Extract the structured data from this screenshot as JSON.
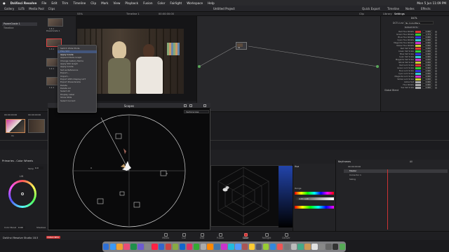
{
  "menubar": {
    "apple": "",
    "app": "DaVinci Resolve",
    "items": [
      "File",
      "Edit",
      "Trim",
      "Timeline",
      "Clip",
      "Mark",
      "View",
      "Playback",
      "Fusion",
      "Color",
      "Fairlight",
      "Workspace",
      "Help"
    ],
    "clock": "Mon 5 Jun 11:09 PM"
  },
  "toolbar": {
    "left": [
      "Gallery",
      "LUTs",
      "Media Pool",
      "Clips"
    ],
    "project_title": "Untitled Project",
    "right": [
      "Quick Export",
      "Timeline",
      "Nodes",
      "Effects"
    ]
  },
  "secondary": {
    "zoom": "53%",
    "timeline_label": "Timeline 1",
    "timecode": "00:00:00:00",
    "clip_label": "Clip",
    "library_tab": "Library",
    "settings_tab": "Settings"
  },
  "gallery": {
    "albums": [
      "PowerGrade 1",
      "Timeline"
    ],
    "stills": [
      {
        "label": "1.6.1",
        "sub": "PowerGrade 1"
      },
      {
        "label": "1.3.1",
        "sub": ""
      },
      {
        "label": "1.2.1",
        "sub": ""
      },
      {
        "label": "1.1.1",
        "sub": ""
      }
    ]
  },
  "context_menu": {
    "items": [
      "Switch Wide Mode",
      "Play Still",
      "Apply Grade",
      "Append Node Graph",
      "Change Gallery Name",
      "Apply Still Graph",
      "Apply Grade",
      "Set as Reference",
      "Export...",
      "Import...",
      "Export With Display LUT",
      "Export PowerGrade",
      "Delete",
      "Delete All",
      "Select All",
      "Display Label",
      "Show Stills",
      "Select Current"
    ],
    "highlighted_index": 2
  },
  "right_panel": {
    "header": "DCTL",
    "dctl_label": "DCTL List",
    "dctl_value": "No ColorWarp",
    "sub": "Default DCTL",
    "rows": [
      {
        "label": "Red Hue Rotate",
        "color": "#d33",
        "value": "0.000"
      },
      {
        "label": "Green Hue Rotate",
        "color": "#3c3",
        "value": "1.374"
      },
      {
        "label": "Blue Hue Rotate",
        "color": "#33d",
        "value": "0.000"
      },
      {
        "label": "Cyan Hue Rotate",
        "color": "#3cc",
        "value": "0.000"
      },
      {
        "label": "Magenta Hue Rotate",
        "color": "#c3c",
        "value": "0.000"
      },
      {
        "label": "Yellow Hue Rotate",
        "color": "#cc3",
        "value": "0.000"
      },
      {
        "label": "Red Sat Scale",
        "color": "#d33",
        "value": "0.000"
      },
      {
        "label": "Green Sat Scale",
        "color": "#3c3",
        "value": "0.000"
      },
      {
        "label": "Blue Sat Scale",
        "color": "#33d",
        "value": "0.000"
      },
      {
        "label": "Cyan Sat Scale",
        "color": "#3cc",
        "value": "0.000"
      },
      {
        "label": "Magenta Sat Scale",
        "color": "#c3c",
        "value": "0.000"
      },
      {
        "label": "Yellow Sat Scale",
        "color": "#cc3",
        "value": "0.000"
      },
      {
        "label": "Red Lum Scale",
        "color": "#d33",
        "value": "0.000"
      },
      {
        "label": "Green Lum Scale",
        "color": "#3c3",
        "value": "0.000"
      },
      {
        "label": "Blue Lum Scale",
        "color": "#33d",
        "value": "0.000"
      },
      {
        "label": "Cyan Lum Scale",
        "color": "#3cc",
        "value": "0.000"
      },
      {
        "label": "Magenta Lum Scale",
        "color": "#c3c",
        "value": "0.000"
      },
      {
        "label": "Yellow Lum Scale",
        "color": "#cc3",
        "value": "0.000"
      },
      {
        "label": "Global Sat",
        "color": "#aaa",
        "value": "0.000"
      },
      {
        "label": "Hue Rotate",
        "color": "#aaa",
        "value": "0.000"
      },
      {
        "label": "Hue Sat Scale",
        "color": "#aaa",
        "value": "0.000"
      }
    ],
    "footer": "Global Blend"
  },
  "node": {
    "label": "01"
  },
  "scopes": {
    "title": "Scopes",
    "mode": "Vectorscope",
    "targets": [
      "R",
      "Mg",
      "B",
      "Cy",
      "G",
      "Yl"
    ]
  },
  "strip": {
    "clip1_tc": "00:00:00:00",
    "clip2_tc": "00:00:00:00",
    "codec": "V1"
  },
  "color_wheels": {
    "title": "Primaries - Color Wheels",
    "temp_label": "Temp",
    "temp_value": "0.0",
    "lift_label": "Lift",
    "color_boost_label": "Color Boost",
    "color_boost_value": "0.00",
    "shadows_label": "Shadows"
  },
  "hsl": {
    "title": "Hue",
    "range_label": "Range",
    "auto_lock": "Auto Lock"
  },
  "keyframes": {
    "title": "Keyframes",
    "filter": "All",
    "tc": "00:00:00:00",
    "rows": [
      "Master",
      "Corrector 1",
      "Sizing"
    ]
  },
  "pages": [
    "Media",
    "Cut",
    "Edit",
    "Fusion",
    "Color",
    "Fairlight",
    "Deliver"
  ],
  "active_page": "Color",
  "version": "DaVinci Resolve Studio 18.5",
  "badge": "PUBLIC BETA",
  "dock_colors": [
    "#2e6fd6",
    "#3b99f5",
    "#f0a030",
    "#e94e77",
    "#1f8f4a",
    "#6d5bd0",
    "#888",
    "#f24",
    "#36c",
    "#c44",
    "#8a4",
    "#16c",
    "#d36",
    "#3a3",
    "#aaa",
    "#f80",
    "#47a",
    "#c3c",
    "#2bd",
    "#59f",
    "#a55",
    "#fc3",
    "#556",
    "#9c3",
    "#38d",
    "#e55",
    "#777",
    "#bbb",
    "#4a8",
    "#c95",
    "#e0e0e0",
    "#888",
    "#666",
    "#333",
    "#5a5"
  ]
}
